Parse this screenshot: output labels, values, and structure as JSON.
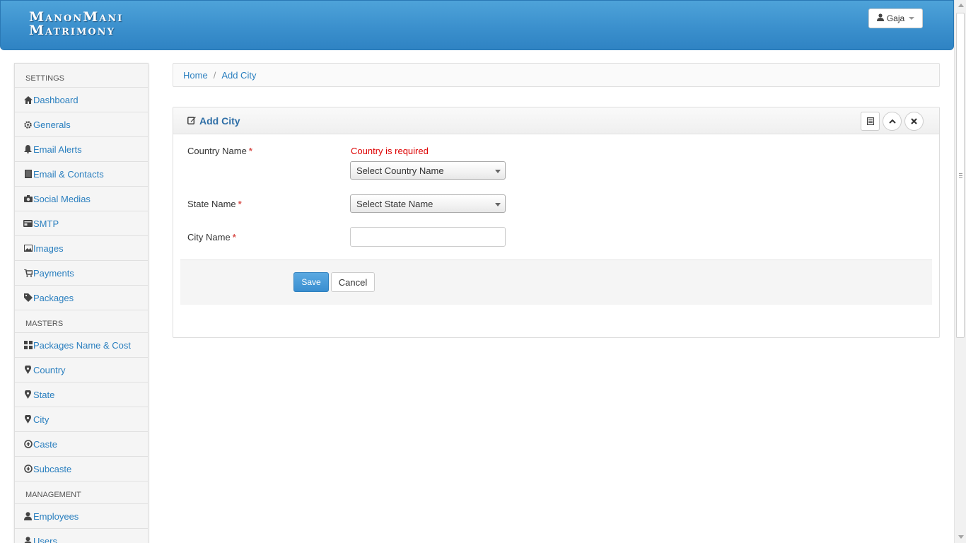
{
  "header": {
    "logo_line1": "ManonMani",
    "logo_line2": "Matrimony",
    "user_name": "Gaja"
  },
  "sidebar": {
    "sections": [
      {
        "title": "SETTINGS",
        "items": [
          {
            "label": "Dashboard",
            "icon": "home-icon"
          },
          {
            "label": "Generals",
            "icon": "gear-icon"
          },
          {
            "label": "Email Alerts",
            "icon": "bell-icon"
          },
          {
            "label": "Email & Contacts",
            "icon": "book-icon"
          },
          {
            "label": "Social Medias",
            "icon": "camera-icon"
          },
          {
            "label": "SMTP",
            "icon": "server-icon"
          },
          {
            "label": "Images",
            "icon": "picture-icon"
          },
          {
            "label": "Payments",
            "icon": "cart-icon"
          },
          {
            "label": "Packages",
            "icon": "tag-icon"
          }
        ]
      },
      {
        "title": "MASTERS",
        "items": [
          {
            "label": "Packages Name & Cost",
            "icon": "grid-icon"
          },
          {
            "label": "Country",
            "icon": "map-marker-icon"
          },
          {
            "label": "State",
            "icon": "map-marker-icon"
          },
          {
            "label": "City",
            "icon": "map-marker-icon"
          },
          {
            "label": "Caste",
            "icon": "circle-arrow-up-icon"
          },
          {
            "label": "Subcaste",
            "icon": "circle-arrow-down-icon"
          }
        ]
      },
      {
        "title": "MANAGEMENT",
        "items": [
          {
            "label": "Employees",
            "icon": "user-icon"
          },
          {
            "label": "Users",
            "icon": "user-icon"
          }
        ]
      }
    ]
  },
  "breadcrumb": {
    "home": "Home",
    "separator": "/",
    "current": "Add City"
  },
  "panel": {
    "title": "Add City"
  },
  "form": {
    "country_label": "Country Name",
    "country_error": "Country is required",
    "country_select": "Select Country Name",
    "state_label": "State Name",
    "state_select": "Select State Name",
    "city_label": "City Name",
    "city_value": "",
    "required_mark": "*",
    "save_label": "Save",
    "cancel_label": "Cancel"
  },
  "colors": {
    "header_blue": "#3b90cd",
    "link_blue": "#2a7fbf",
    "error_red": "#dd0000",
    "save_blue": "#3a8fd0"
  }
}
